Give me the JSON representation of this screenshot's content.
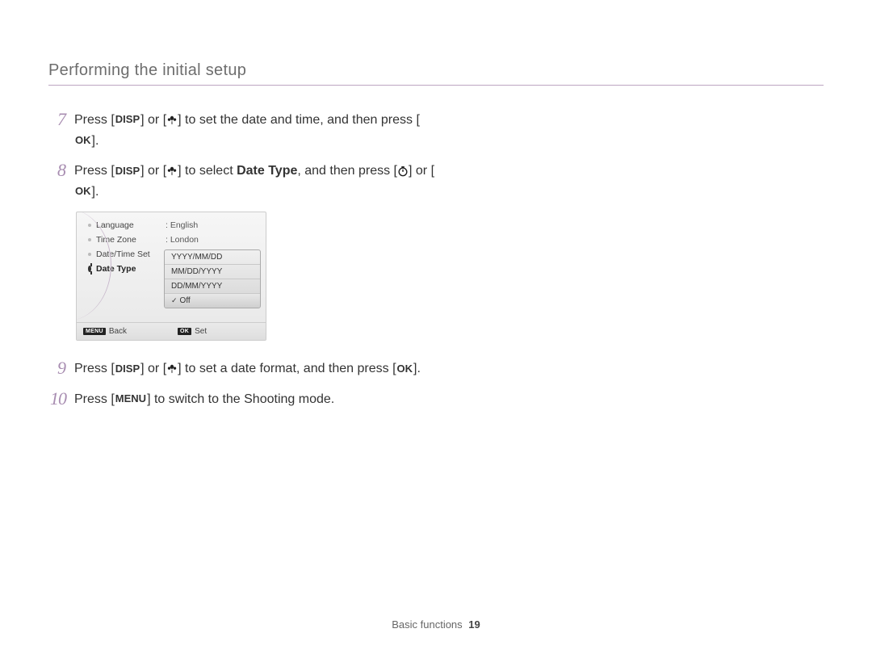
{
  "title": "Performing the initial setup",
  "steps": {
    "s7": {
      "num": "7",
      "pre": "Press [",
      "disp": "DISP",
      "mid1": "] or [",
      "mid2": "] to set the date and time, and then press [",
      "ok": "OK",
      "end": "]."
    },
    "s8": {
      "num": "8",
      "pre": "Press [",
      "disp": "DISP",
      "mid1": "] or [",
      "mid2": "] to select ",
      "dt": "Date Type",
      "mid3": ", and then press [",
      "mid4": "] or [",
      "ok": "OK",
      "end": "]."
    },
    "s9": {
      "num": "9",
      "pre": "Press [",
      "disp": "DISP",
      "mid1": "] or [",
      "mid2": "] to set a date format, and then press [",
      "ok": "OK",
      "end": "]."
    },
    "s10": {
      "num": "10",
      "pre": "Press [",
      "menu": "MENU",
      "end": "] to switch to the Shooting mode."
    }
  },
  "screen": {
    "menu": {
      "language": "Language",
      "timezone": "Time Zone",
      "datetime": "Date/Time Set",
      "datetype": "Date Type"
    },
    "values": {
      "language": ": English",
      "timezone": ": London"
    },
    "options": {
      "o1": "YYYY/MM/DD",
      "o2": "MM/DD/YYYY",
      "o3": "DD/MM/YYYY",
      "o4": "Off"
    },
    "footer": {
      "backTag": "MENU",
      "back": "Back",
      "setTag": "OK",
      "set": "Set"
    }
  },
  "footer": {
    "section": "Basic functions",
    "page": "19"
  }
}
